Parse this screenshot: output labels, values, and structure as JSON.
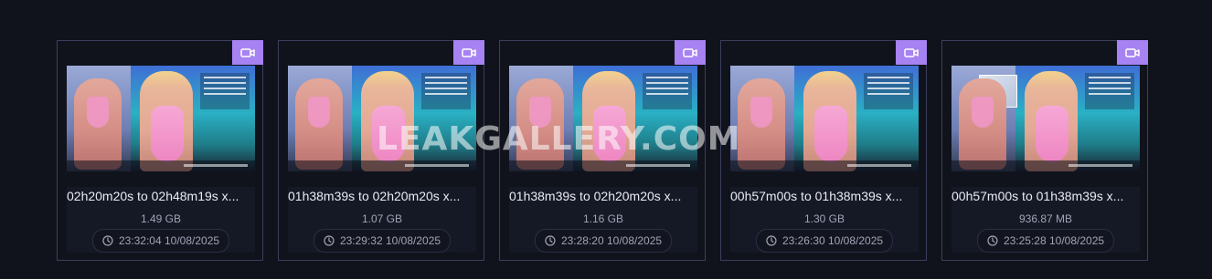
{
  "videos": [
    {
      "title": "02h20m20s to 02h48m19s x...",
      "size": "1.49 GB",
      "datetime": "23:32:04 10/08/2025"
    },
    {
      "title": "01h38m39s to 02h20m20s x...",
      "size": "1.07 GB",
      "datetime": "23:29:32 10/08/2025"
    },
    {
      "title": "01h38m39s to 02h20m20s x...",
      "size": "1.16 GB",
      "datetime": "23:28:20 10/08/2025"
    },
    {
      "title": "00h57m00s to 01h38m39s x...",
      "size": "1.30 GB",
      "datetime": "23:26:30 10/08/2025"
    },
    {
      "title": "00h57m00s to 01h38m39s x...",
      "size": "936.87 MB",
      "datetime": "23:25:28 10/08/2025"
    }
  ],
  "watermark": "LEAKGALLERY.COM",
  "icons": {
    "badge": "video-camera-icon",
    "date": "clock-icon"
  },
  "colors": {
    "accent": "#a782f2",
    "background": "#10131c",
    "card_border": "#3b3f5c"
  }
}
